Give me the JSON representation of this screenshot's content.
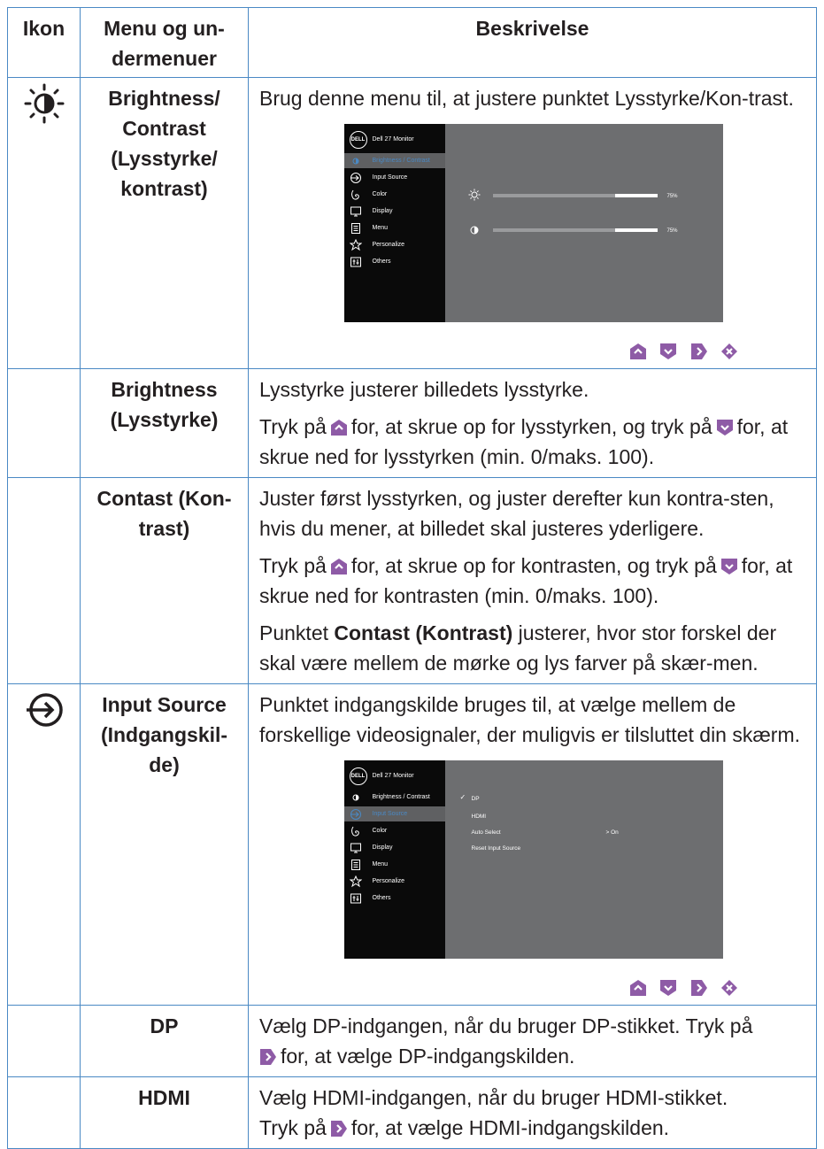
{
  "headers": {
    "icon": "Ikon",
    "menu": "Menu og un-dermenuer",
    "desc": "Beskrivelse"
  },
  "rows": {
    "brightness_contrast": {
      "icon": "brightness-icon",
      "menu": "Brightness/ Contrast (Lysstyrke/ kontrast)",
      "desc": "Brug denne menu til, at justere punktet Lysstyrke/Kon-trast."
    },
    "brightness": {
      "menu": "Brightness (Lysstyrke)",
      "p1": "Lysstyrke justerer billedets lysstyrke.",
      "p2_a": "Tryk på",
      "p2_b": "for, at skrue op for lysstyrken, og tryk på",
      "p2_c": "for, at skrue ned for lysstyrken (min. 0/maks. 100)."
    },
    "contrast": {
      "menu": "Contast (Kon-trast)",
      "p1": "Juster først lysstyrken, og juster derefter kun kontra-sten, hvis du mener, at billedet skal justeres yderligere.",
      "p2_a": "Tryk på",
      "p2_b": "for, at skrue op for kontrasten, og tryk på",
      "p2_c": "for, at skrue ned for kontrasten (min. 0/maks. 100).",
      "p3_a": "Punktet",
      "p3_bold": "Contast (Kontrast)",
      "p3_b": "justerer, hvor stor forskel der skal være mellem de mørke og lys farver på skær-men."
    },
    "input_source": {
      "icon": "input-source-icon",
      "menu": "Input Source (Indgangskil-de)",
      "desc": "Punktet indgangskilde bruges til, at vælge mellem de forskellige videosignaler, der muligvis er tilsluttet din skærm."
    },
    "dp": {
      "menu": "DP",
      "desc_a": "Vælg DP-indgangen, når du bruger DP-stikket. Tryk på",
      "desc_b": "for, at vælge DP-indgangskilden."
    },
    "hdmi": {
      "menu": "HDMI",
      "desc_a": "Vælg HDMI-indgangen, når du bruger HDMI-stikket.",
      "desc_b": "Tryk på",
      "desc_c": "for, at vælge HDMI-indgangskilden."
    }
  },
  "osd": {
    "logo": "DELL",
    "model": "Dell 27 Monitor",
    "menu_items": [
      "Brightness / Contrast",
      "Input Source",
      "Color",
      "Display",
      "Menu",
      "Personalize",
      "Others"
    ],
    "screen1": {
      "selected": "Brightness / Contrast",
      "brightness_value": 75,
      "brightness_label": "75%",
      "contrast_value": 75,
      "contrast_label": "75%"
    },
    "screen2": {
      "selected": "Input Source",
      "options": [
        "DP",
        "HDMI",
        "Auto Select",
        "Reset Input Source"
      ],
      "checked": "DP",
      "auto_select_value": "> On"
    }
  },
  "colors": {
    "border": "#4a89c4",
    "osd_bg": "#6d6e70",
    "osd_side": "#0a0a0a",
    "button": "#8e5ba6"
  }
}
